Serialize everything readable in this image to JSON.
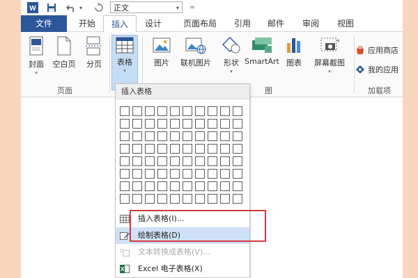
{
  "qat": {
    "word_logo": "W",
    "style_value": "正文",
    "more": "="
  },
  "tabs": [
    {
      "label": "文件"
    },
    {
      "label": "开始"
    },
    {
      "label": "插入"
    },
    {
      "label": "设计"
    },
    {
      "label": "页面布局"
    },
    {
      "label": "引用"
    },
    {
      "label": "邮件"
    },
    {
      "label": "审阅"
    },
    {
      "label": "视图"
    }
  ],
  "ribbon": {
    "buttons": {
      "cover": "封面",
      "blank_page": "空白页",
      "page_break": "分页",
      "table": "表格",
      "picture": "图片",
      "online_picture": "联机图片",
      "shapes": "形状",
      "smartart": "SmartArt",
      "chart": "图表",
      "screenshot": "屏幕截图"
    },
    "groups": {
      "pages": "页面",
      "illustrations": "图",
      "addins": "加载项"
    },
    "addins": {
      "store": "应用商店",
      "my_apps": "我的应用"
    }
  },
  "table_menu": {
    "title": "插入表格",
    "items": [
      {
        "label": "插入表格(I)..."
      },
      {
        "label": "绘制表格(D)"
      },
      {
        "label": "文本转换成表格(V)..."
      },
      {
        "label": "Excel 电子表格(X)"
      }
    ]
  },
  "colors": {
    "accent": "#2b579a",
    "background": "#f8d5bd",
    "highlight": "#d9363e"
  }
}
